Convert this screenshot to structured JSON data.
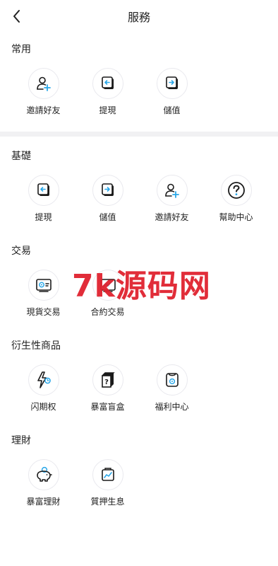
{
  "header": {
    "title": "服務"
  },
  "sections": [
    {
      "title": "常用",
      "items": [
        {
          "label": "邀請好友",
          "icon": "invite-friend-icon"
        },
        {
          "label": "提現",
          "icon": "withdraw-icon"
        },
        {
          "label": "儲值",
          "icon": "deposit-icon"
        }
      ]
    },
    {
      "title": "基礎",
      "items": [
        {
          "label": "提現",
          "icon": "withdraw-icon"
        },
        {
          "label": "儲值",
          "icon": "deposit-icon"
        },
        {
          "label": "邀請好友",
          "icon": "invite-friend-icon"
        },
        {
          "label": "幫助中心",
          "icon": "help-center-icon"
        }
      ]
    },
    {
      "title": "交易",
      "items": [
        {
          "label": "現貨交易",
          "icon": "spot-trading-icon"
        },
        {
          "label": "合約交易",
          "icon": "contract-trading-icon"
        }
      ]
    },
    {
      "title": "衍生性商品",
      "items": [
        {
          "label": "闪期权",
          "icon": "flash-option-icon"
        },
        {
          "label": "暴富盲盒",
          "icon": "blind-box-icon"
        },
        {
          "label": "福利中心",
          "icon": "welfare-center-icon"
        }
      ]
    },
    {
      "title": "理財",
      "items": [
        {
          "label": "暴富理財",
          "icon": "piggy-bank-icon"
        },
        {
          "label": "質押生息",
          "icon": "staking-icon"
        }
      ]
    }
  ],
  "watermark": "7k源码网",
  "colors": {
    "accent": "#2aa7e8",
    "dark": "#1a1a1a",
    "watermark": "#e0222f",
    "divider": "#f1f1f3"
  }
}
